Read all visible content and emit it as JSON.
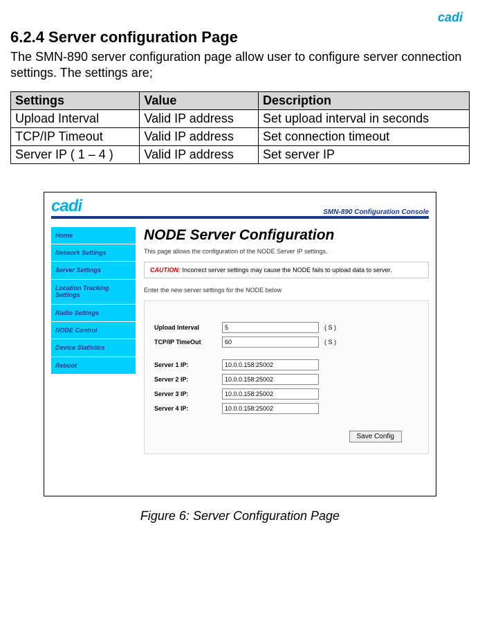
{
  "top_logo": "cadi",
  "section_heading": "6.2.4 Server configuration Page",
  "intro": "The SMN-890 server configuration page allow user to configure server connection settings. The settings are;",
  "settings_table": {
    "headers": [
      "Settings",
      "Value",
      "Description"
    ],
    "rows": [
      [
        "Upload Interval",
        "Valid IP address",
        "Set upload interval in seconds"
      ],
      [
        "TCP/IP Timeout",
        "Valid IP address",
        "Set connection timeout"
      ],
      [
        "Server IP ( 1 – 4 )",
        "Valid IP address",
        "Set server IP"
      ]
    ]
  },
  "screenshot": {
    "logo": "cadi",
    "console_label": "SMN-890 Configuration Console",
    "sidebar": [
      "Home",
      "Network Settings",
      "Server Settings",
      "Location Tracking Settings",
      "Radio Settings",
      "NODE Control",
      "Device Statistics",
      "Reboot"
    ],
    "main": {
      "title": "NODE Server Configuration",
      "subtitle": "This page allows the configuration of the NODE Server IP settings.",
      "caution_label": "CAUTION:",
      "caution_text": " Incorrect server settings may cause the NODE fails to upload data to server.",
      "enter_text": "Enter the new server settings for the NODE below",
      "rows": [
        {
          "label": "Upload Interval",
          "value": "5",
          "unit": "( S )"
        },
        {
          "label": "TCP/IP TimeOut",
          "value": "60",
          "unit": "( S )"
        }
      ],
      "servers": [
        {
          "label": "Server 1 IP:",
          "value": "10.0.0.158:25002"
        },
        {
          "label": "Server 2 IP:",
          "value": "10.0.0.158:25002"
        },
        {
          "label": "Server 3 IP:",
          "value": "10.0.0.158:25002"
        },
        {
          "label": "Server 4 IP:",
          "value": "10.0.0.158:25002"
        }
      ],
      "save_label": "Save Config"
    }
  },
  "figure_caption": "Figure 6: Server Configuration Page"
}
